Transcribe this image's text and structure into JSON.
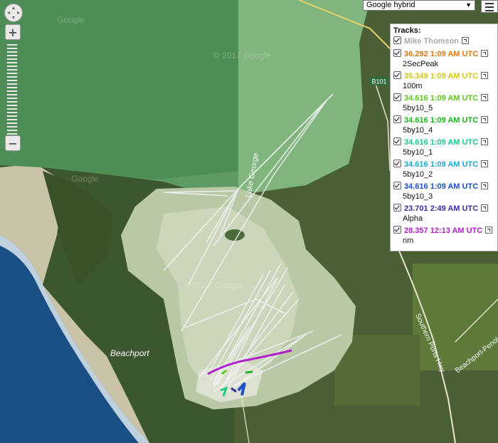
{
  "map": {
    "map_type": "Google hybrid",
    "place_labels": {
      "beachport": "Beachport",
      "lake_george": "Lake George",
      "road_b101": "B101",
      "southern_ports_hwy": "Southern Ports Hwy",
      "beachport_penola": "Beachport-Penola",
      "watermarks": [
        "© 2017 Google",
        "Google",
        "© 2017 Google",
        "Google"
      ]
    }
  },
  "controls": {
    "zoom_in": "+",
    "zoom_out": "−"
  },
  "tracks_panel": {
    "heading": "Tracks:",
    "group": "Mike Thomson",
    "tracks": [
      {
        "value": "36.292 1:09 AM UTC",
        "name": "2SecPeak",
        "color": "#e07a18"
      },
      {
        "value": "35.349 1:09 AM UTC",
        "name": "100m",
        "color": "#d4c914"
      },
      {
        "value": "34.616 1:09 AM UTC",
        "name": "5by10_5",
        "color": "#5ec81e"
      },
      {
        "value": "34.616 1:09 AM UTC",
        "name": "5by10_4",
        "color": "#1fb51f"
      },
      {
        "value": "34.616 1:09 AM UTC",
        "name": "5by10_1",
        "color": "#1fc98a"
      },
      {
        "value": "34.616 1:09 AM UTC",
        "name": "5by10_2",
        "color": "#1fa9d0"
      },
      {
        "value": "34.616 1:09 AM UTC",
        "name": "5by10_3",
        "color": "#1f4fc9"
      },
      {
        "value": "23.701 2:49 AM UTC",
        "name": "Alpha",
        "color": "#3a2f9a"
      },
      {
        "value": "28.357 12:13 AM UTC",
        "name": "nm",
        "color": "#b01fc9"
      }
    ]
  }
}
